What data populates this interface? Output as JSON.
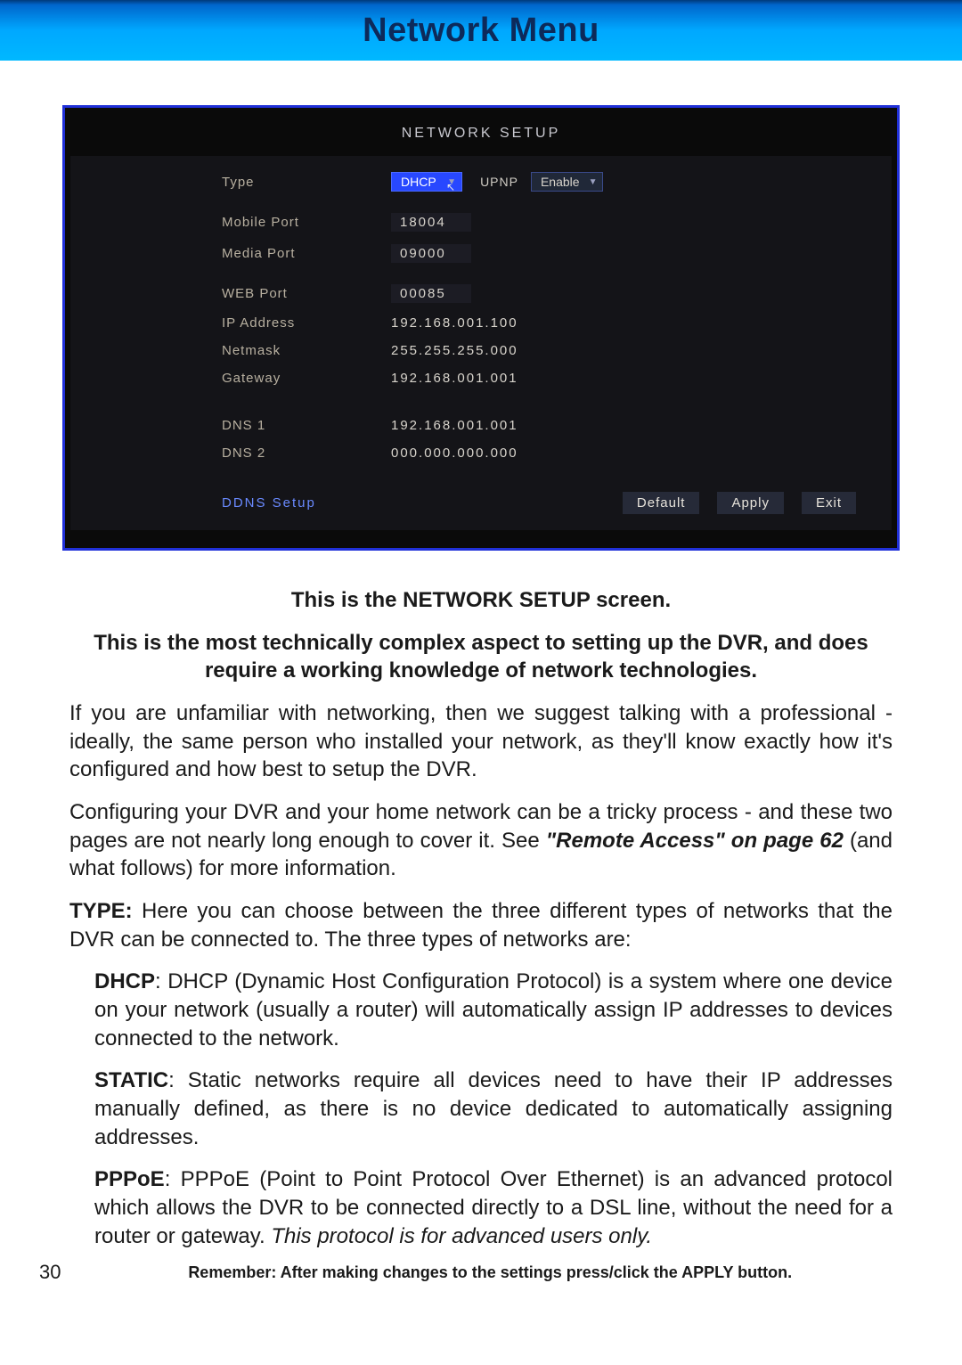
{
  "banner": {
    "title": "Network Menu"
  },
  "dvr": {
    "title": "NETWORK  SETUP",
    "type_label": "Type",
    "type_value": "DHCP",
    "upnp_label": "UPNP",
    "upnp_value": "Enable",
    "rows": [
      {
        "label": "Mobile  Port",
        "value": "18004",
        "boxed": true
      },
      {
        "label": "Media  Port",
        "value": "09000",
        "boxed": true
      },
      {
        "label": "WEB  Port",
        "value": "00085",
        "boxed": true
      },
      {
        "label": "IP  Address",
        "value": "192.168.001.100",
        "boxed": false
      },
      {
        "label": "Netmask",
        "value": "255.255.255.000",
        "boxed": false
      },
      {
        "label": "Gateway",
        "value": "192.168.001.001",
        "boxed": false
      }
    ],
    "dns_rows": [
      {
        "label": "DNS  1",
        "value": "192.168.001.001"
      },
      {
        "label": "DNS  2",
        "value": "000.000.000.000"
      }
    ],
    "ddns": "DDNS  Setup",
    "buttons": {
      "default": "Default",
      "apply": "Apply",
      "exit": "Exit"
    }
  },
  "doc": {
    "p1": "This is the NETWORK SETUP screen.",
    "p2": "This is the most technically complex aspect to setting up the DVR, and does require a working knowledge of network technologies.",
    "p3": "If you are unfamiliar with networking, then we suggest talking with a professional - ideally, the same person who installed your network, as they'll know exactly how it's configured and how best to setup the DVR.",
    "p4a": "Configuring your DVR and your home network can be a tricky process - and these two pages are not nearly long enough to cover it. See ",
    "p4ref": "\"Remote Access\" on page 62",
    "p4b": " (and what follows) for more information.",
    "p5lead": "TYPE:",
    "p5": " Here you can choose between the three different types of networks that the DVR can be connected to. The three types of networks are:",
    "dhcp_lead": "DHCP",
    "dhcp": ": DHCP (Dynamic Host Configuration Protocol) is a system where one device on your network (usually a router) will automatically assign IP addresses to devices connected to the network.",
    "static_lead": "STATIC",
    "static": ": Static networks require all devices need to have their IP addresses manually defined, as there is no device dedicated to automatically assigning addresses.",
    "pppoe_lead": "PPPoE",
    "pppoe_a": ": PPPoE (Point to Point Protocol Over Ethernet) is an advanced protocol which allows the DVR to be connected directly to a DSL line, without the need for a router or gateway. ",
    "pppoe_i": "This protocol is for advanced users only."
  },
  "footer": {
    "page": "30",
    "note": "Remember: After making changes to the settings press/click the APPLY button."
  }
}
